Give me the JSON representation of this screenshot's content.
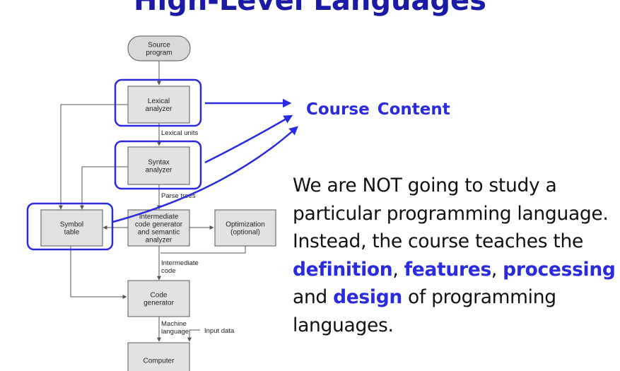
{
  "title": "High-Level Languages",
  "diagram": {
    "nodes": {
      "source": [
        "Source",
        "program"
      ],
      "lexical": [
        "Lexical",
        "analyzer"
      ],
      "syntax": [
        "Syntax",
        "analyzer"
      ],
      "symbol": [
        "Symbol",
        "table"
      ],
      "intermediate": [
        "Intermediate",
        "code generator",
        "and semantic",
        "analyzer"
      ],
      "optimization": [
        "Optimization",
        "(optional)"
      ],
      "codegen": [
        "Code",
        "generator"
      ],
      "computer": [
        "Computer"
      ]
    },
    "edge_labels": {
      "lexical_units": [
        "Lexical units"
      ],
      "parse_trees": [
        "Parse trees"
      ],
      "intermediate_code": [
        "Intermediate",
        "code"
      ],
      "machine_language": [
        "Machine",
        "language"
      ],
      "input_data": [
        "Input data"
      ]
    }
  },
  "callout": "Course Content",
  "body": {
    "line1": "We are NOT going to study a",
    "line2": "particular programming language.",
    "line3": "Instead, the course teaches the",
    "kw1": "definition",
    "sep1": ", ",
    "kw2": "features",
    "sep2": ", ",
    "kw3": "processing",
    "line5_pre": "and ",
    "kw4": "design",
    "line5_post": " of programming",
    "line6": "languages."
  },
  "colors": {
    "accent_blue": "#2a2ae0",
    "title_blue": "#1a1aa6",
    "box_fill": "#e2e2e2",
    "source_fill": "#d9d9d9"
  }
}
